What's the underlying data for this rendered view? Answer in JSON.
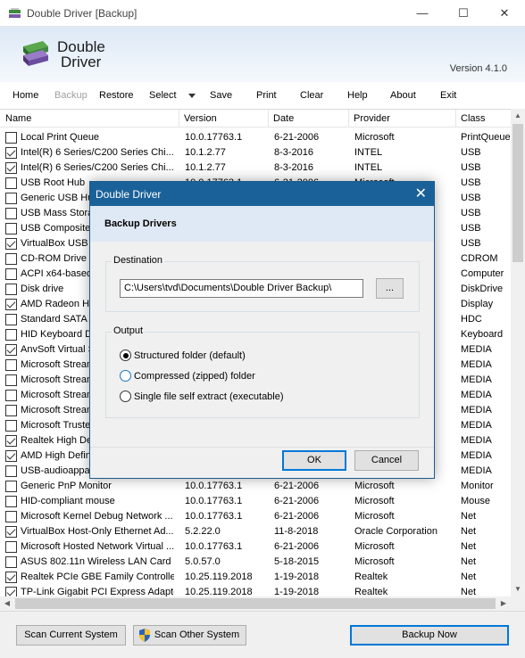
{
  "window": {
    "title": "Double Driver [Backup]",
    "minimize": "—",
    "maximize": "☐",
    "close": "✕"
  },
  "banner": {
    "logo_line1": "Double",
    "logo_line2": "Driver",
    "version": "Version 4.1.0"
  },
  "menu": {
    "home": "Home",
    "backup": "Backup",
    "restore": "Restore",
    "select": "Select",
    "save": "Save",
    "print": "Print",
    "clear": "Clear",
    "help": "Help",
    "about": "About",
    "exit": "Exit"
  },
  "columns": {
    "name": "Name",
    "version": "Version",
    "date": "Date",
    "provider": "Provider",
    "class": "Class"
  },
  "rows": [
    {
      "checked": false,
      "name": "Local Print Queue",
      "version": "10.0.17763.1",
      "date": "6-21-2006",
      "provider": "Microsoft",
      "class": "PrintQueue"
    },
    {
      "checked": true,
      "name": "Intel(R) 6 Series/C200 Series Chi...",
      "version": "10.1.2.77",
      "date": "8-3-2016",
      "provider": "INTEL",
      "class": "USB"
    },
    {
      "checked": true,
      "name": "Intel(R) 6 Series/C200 Series Chi...",
      "version": "10.1.2.77",
      "date": "8-3-2016",
      "provider": "INTEL",
      "class": "USB"
    },
    {
      "checked": false,
      "name": "USB Root Hub",
      "version": "10.0.17763.1",
      "date": "6-21-2006",
      "provider": "Microsoft",
      "class": "USB"
    },
    {
      "checked": false,
      "name": "Generic USB Hub",
      "version": "",
      "date": "",
      "provider": "",
      "class": "USB"
    },
    {
      "checked": false,
      "name": "USB Mass Storage",
      "version": "",
      "date": "",
      "provider": "",
      "class": "USB"
    },
    {
      "checked": false,
      "name": "USB Composite D",
      "version": "",
      "date": "",
      "provider": "",
      "class": "USB"
    },
    {
      "checked": true,
      "name": "VirtualBox USB",
      "version": "",
      "date": "",
      "provider": "",
      "class": "USB"
    },
    {
      "checked": false,
      "name": "CD-ROM Drive",
      "version": "",
      "date": "",
      "provider": "",
      "class": "CDROM"
    },
    {
      "checked": false,
      "name": "ACPI x64-based",
      "version": "",
      "date": "",
      "provider": "",
      "class": "Computer"
    },
    {
      "checked": false,
      "name": "Disk drive",
      "version": "",
      "date": "",
      "provider": "",
      "class": "DiskDrive"
    },
    {
      "checked": true,
      "name": "AMD Radeon HD",
      "version": "",
      "date": "",
      "provider": "...",
      "class": "Display"
    },
    {
      "checked": false,
      "name": "Standard SATA A",
      "version": "",
      "date": "",
      "provider": "",
      "class": "HDC"
    },
    {
      "checked": false,
      "name": "HID Keyboard D",
      "version": "",
      "date": "",
      "provider": "",
      "class": "Keyboard"
    },
    {
      "checked": true,
      "name": "AnvSoft Virtual S",
      "version": "",
      "date": "",
      "provider": "",
      "class": "MEDIA"
    },
    {
      "checked": false,
      "name": "Microsoft Stream",
      "version": "",
      "date": "",
      "provider": "",
      "class": "MEDIA"
    },
    {
      "checked": false,
      "name": "Microsoft Stream",
      "version": "",
      "date": "",
      "provider": "",
      "class": "MEDIA"
    },
    {
      "checked": false,
      "name": "Microsoft Stream",
      "version": "",
      "date": "",
      "provider": "",
      "class": "MEDIA"
    },
    {
      "checked": false,
      "name": "Microsoft Stream",
      "version": "",
      "date": "",
      "provider": "",
      "class": "MEDIA"
    },
    {
      "checked": false,
      "name": "Microsoft Truste",
      "version": "",
      "date": "",
      "provider": "",
      "class": "MEDIA"
    },
    {
      "checked": true,
      "name": "Realtek High De",
      "version": "",
      "date": "",
      "provider": "...",
      "class": "MEDIA"
    },
    {
      "checked": true,
      "name": "AMD High Definit",
      "version": "",
      "date": "",
      "provider": "...",
      "class": "MEDIA"
    },
    {
      "checked": false,
      "name": "USB-audioappar",
      "version": "",
      "date": "",
      "provider": "",
      "class": "MEDIA"
    },
    {
      "checked": false,
      "name": "Generic PnP Monitor",
      "version": "10.0.17763.1",
      "date": "6-21-2006",
      "provider": "Microsoft",
      "class": "Monitor"
    },
    {
      "checked": false,
      "name": "HID-compliant mouse",
      "version": "10.0.17763.1",
      "date": "6-21-2006",
      "provider": "Microsoft",
      "class": "Mouse"
    },
    {
      "checked": false,
      "name": "Microsoft Kernel Debug Network ...",
      "version": "10.0.17763.1",
      "date": "6-21-2006",
      "provider": "Microsoft",
      "class": "Net"
    },
    {
      "checked": true,
      "name": "VirtualBox Host-Only Ethernet Ad...",
      "version": "5.2.22.0",
      "date": "11-8-2018",
      "provider": "Oracle Corporation",
      "class": "Net"
    },
    {
      "checked": false,
      "name": "Microsoft Hosted Network Virtual ...",
      "version": "10.0.17763.1",
      "date": "6-21-2006",
      "provider": "Microsoft",
      "class": "Net"
    },
    {
      "checked": false,
      "name": "ASUS 802.11n Wireless LAN Card",
      "version": "5.0.57.0",
      "date": "5-18-2015",
      "provider": "Microsoft",
      "class": "Net"
    },
    {
      "checked": true,
      "name": "Realtek PCIe GBE Family Controller",
      "version": "10.25.119.2018",
      "date": "1-19-2018",
      "provider": "Realtek",
      "class": "Net"
    },
    {
      "checked": true,
      "name": "TP-Link Gigabit PCI Express Adapter",
      "version": "10.25.119.2018",
      "date": "1-19-2018",
      "provider": "Realtek",
      "class": "Net"
    }
  ],
  "footer": {
    "scan_current": "Scan Current System",
    "scan_other": "Scan Other System",
    "backup_now": "Backup Now"
  },
  "dialog": {
    "title": "Double Driver",
    "close": "✕",
    "heading": "Backup Drivers",
    "destination_label": "Destination",
    "destination_path": "C:\\Users\\tvd\\Documents\\Double Driver Backup\\",
    "browse": "...",
    "output_label": "Output",
    "options": [
      {
        "label": "Structured folder (default)",
        "selected": true
      },
      {
        "label": "Compressed (zipped) folder",
        "selected": false
      },
      {
        "label": "Single file self extract (executable)",
        "selected": false
      }
    ],
    "ok": "OK",
    "cancel": "Cancel"
  }
}
